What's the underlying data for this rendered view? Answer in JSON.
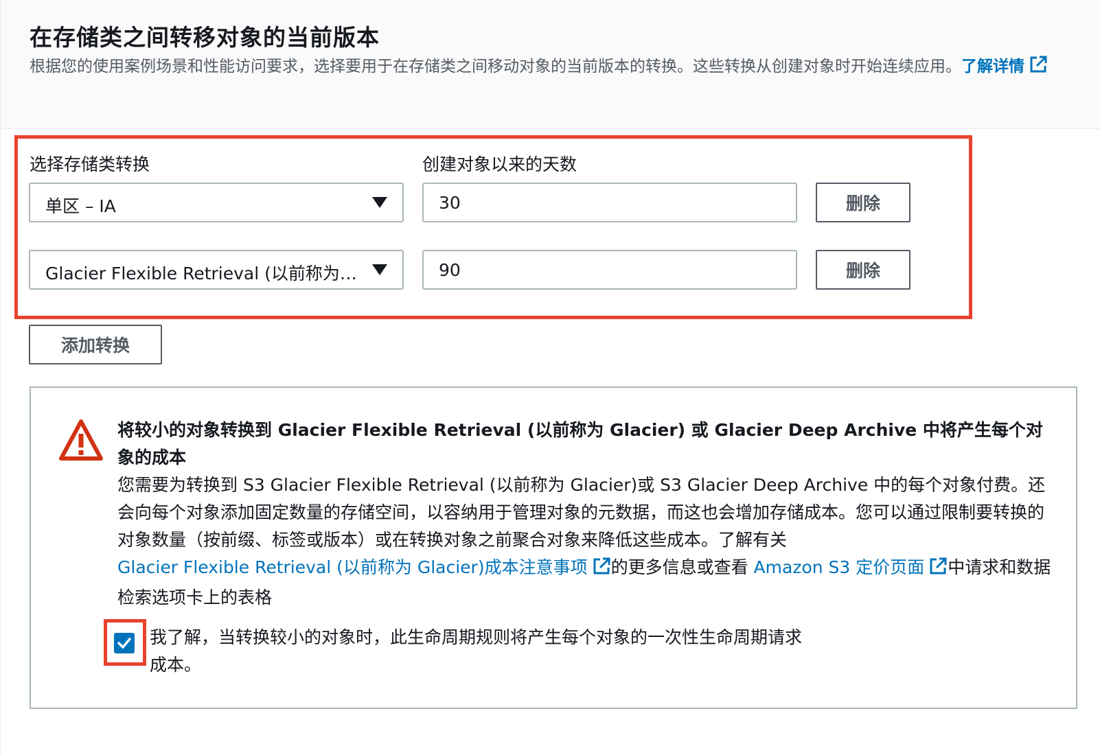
{
  "header": {
    "title": "在存储类之间转移对象的当前版本",
    "description": "根据您的使用案例场景和性能访问要求，选择要用于在存储类之间移动对象的当前版本的转换。这些转换从创建对象时开始连续应用。",
    "learn_more": "了解详情"
  },
  "transitions": {
    "storage_class_label": "选择存储类转换",
    "days_label": "创建对象以来的天数",
    "rows": [
      {
        "storage_class": "单区 – IA",
        "days": "30",
        "remove_label": "删除"
      },
      {
        "storage_class": "Glacier Flexible Retrieval (以前称为…",
        "days": "90",
        "remove_label": "删除"
      }
    ],
    "add_label": "添加转换"
  },
  "alert": {
    "icon": "warning-icon",
    "title": "将较小的对象转换到 Glacier Flexible Retrieval (以前称为 Glacier) 或 Glacier Deep Archive 中将产生每个对象的成本",
    "body_part1": "您需要为转换到 S3 Glacier Flexible Retrieval (以前称为 Glacier)或 S3 Glacier Deep Archive 中的每个对象付费。还会向每个对象添加固定数量的存储空间，以容纳用于管理对象的元数据，而这也会增加存储成本。您可以通过限制要转换的对象数量（按前缀、标签或版本）或在转换对象之前聚合对象来降低这些成本。了解有关",
    "link1": "Glacier Flexible Retrieval (以前称为 Glacier)成本注意事项",
    "body_part2": "的更多信息或查看",
    "link2": "Amazon S3 定价页面",
    "body_part3": "中请求和数据检索选项卡上的表格",
    "ack_checked": true,
    "ack_label": "我了解，当转换较小的对象时，此生命周期规则将产生每个对象的一次性生命周期请求成本。"
  },
  "colors": {
    "link": "#0073bb",
    "highlight": "#e8432e",
    "warning": "#d13212"
  }
}
